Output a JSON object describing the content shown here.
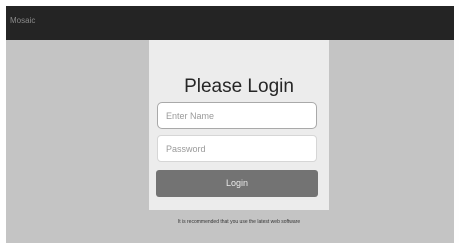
{
  "app": {
    "title": "Mosaic"
  },
  "login": {
    "heading": "Please Login",
    "name_placeholder": "Enter Name",
    "password_placeholder": "Password",
    "button_label": "Login",
    "note": "It is recommended that you use the latest web software"
  }
}
